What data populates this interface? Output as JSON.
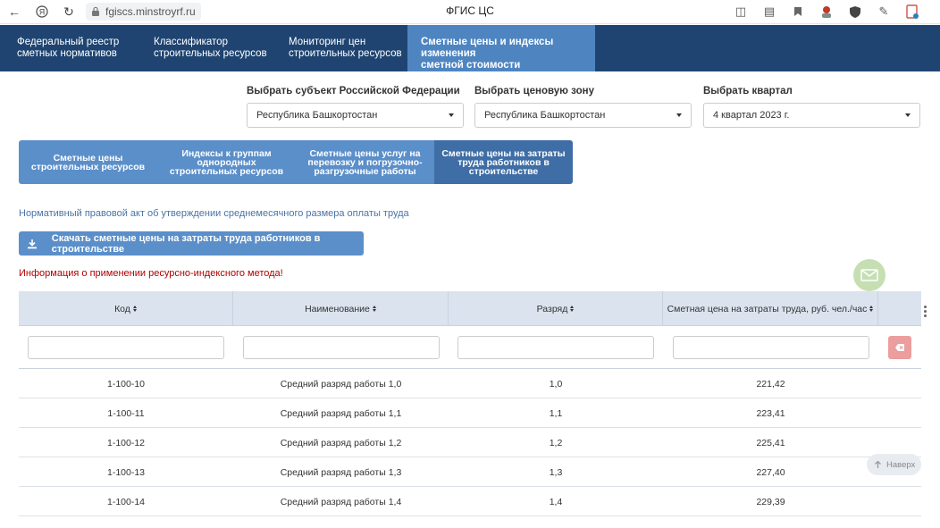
{
  "browser": {
    "url": "fgiscs.minstroyrf.ru",
    "title": "ФГИС ЦС"
  },
  "topnav": {
    "items": [
      {
        "line1": "Федеральный реестр",
        "line2": "сметных нормативов"
      },
      {
        "line1": "Классификатор",
        "line2": "строительных ресурсов"
      },
      {
        "line1": "Мониторинг цен",
        "line2": "строительных ресурсов"
      },
      {
        "line1": "Сметные цены и индексы изменения",
        "line2": "сметной стоимости строительства"
      }
    ],
    "active_index": 3
  },
  "filters": {
    "region": {
      "label": "Выбрать субъект Российской Федерации",
      "value": "Республика Башкортостан"
    },
    "zone": {
      "label": "Выбрать ценовую зону",
      "value": "Республика Башкортостан"
    },
    "quarter": {
      "label": "Выбрать квартал",
      "value": "4 квартал 2023 г."
    }
  },
  "subtabs": [
    {
      "l1": "Сметные цены",
      "l2": "строительных ресурсов",
      "l3": ""
    },
    {
      "l1": "Индексы к группам",
      "l2": "однородных",
      "l3": "строительных ресурсов"
    },
    {
      "l1": "Сметные цены услуг на",
      "l2": "перевозку и погрузочно-",
      "l3": "разгрузочные работы"
    },
    {
      "l1": "Сметные цены на затраты",
      "l2": "труда работников в",
      "l3": "строительстве"
    }
  ],
  "npa_link": "Нормативный правовой акт об утверждении среднемесячного размера оплаты труда",
  "download_label": "Скачать сметные цены на затраты труда работников в строительстве",
  "info_warning": "Информация о применении ресурсно-индексного метода!",
  "table": {
    "headers": [
      "Код",
      "Наименование",
      "Разряд",
      "Сметная цена на затраты труда, руб. чел./час"
    ],
    "rows": [
      [
        "1-100-10",
        "Средний разряд работы 1,0",
        "1,0",
        "221,42"
      ],
      [
        "1-100-11",
        "Средний разряд работы 1,1",
        "1,1",
        "223,41"
      ],
      [
        "1-100-12",
        "Средний разряд работы 1,2",
        "1,2",
        "225,41"
      ],
      [
        "1-100-13",
        "Средний разряд работы 1,3",
        "1,3",
        "227,40"
      ],
      [
        "1-100-14",
        "Средний разряд работы 1,4",
        "1,4",
        "229,39"
      ]
    ]
  },
  "back_to_top": "Наверх",
  "colors": {
    "topnav_bg": "#1f4471",
    "topnav_active": "#4e85c1",
    "tab_bg": "#5b8fc9",
    "warning": "#b00000"
  }
}
